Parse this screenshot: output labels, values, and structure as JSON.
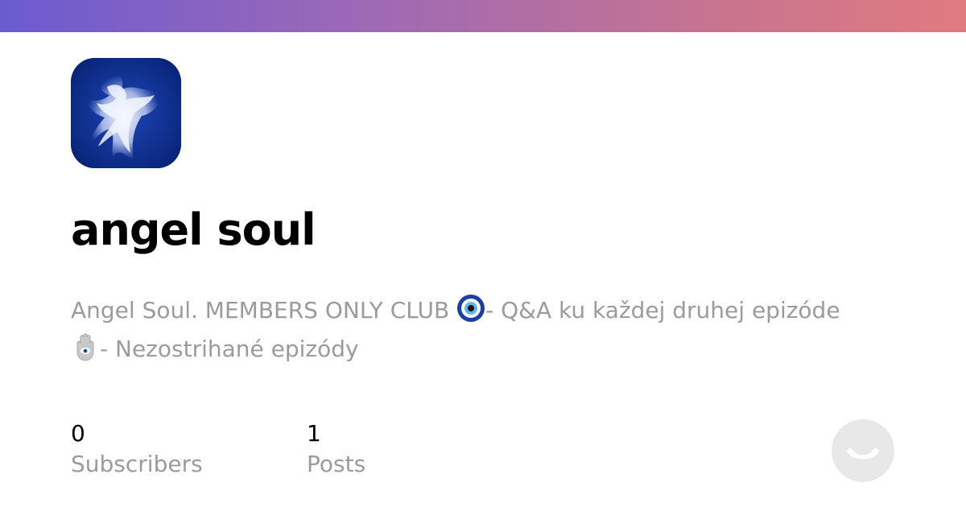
{
  "header": {
    "gradient_start": "#6b5bd0",
    "gradient_end": "#e07a80"
  },
  "avatar": {
    "icon": "angel-avatar-image"
  },
  "publication": {
    "title": "angel soul",
    "description_part1": "Angel Soul. MEMBERS ONLY CLUB ",
    "description_emoji1": "nazar-amulet-icon",
    "description_part2": "- Q&A ku každej druhej epizóde ",
    "description_emoji2": "hamsa-icon",
    "description_part3": "- Nezostrihané epizódy"
  },
  "stats": {
    "subscribers_value": "0",
    "subscribers_label": "Subscribers",
    "posts_value": "1",
    "posts_label": "Posts"
  },
  "brand": {
    "logo_icon": "smiley-logo-icon",
    "logo_color": "#e8e8e8"
  }
}
